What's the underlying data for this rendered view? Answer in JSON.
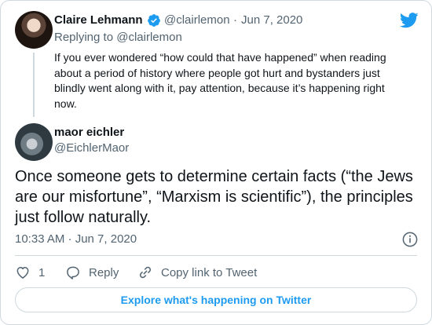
{
  "reply_tweet": {
    "author_name": "Claire Lehmann",
    "handle": "@clairlemon",
    "separator": "·",
    "date": "Jun 7, 2020",
    "replying_to": "Replying to @clairlemon",
    "text": "If you ever wondered “how could that have happened” when reading about a period of history where people got hurt and bystanders just blindly went along with it, pay attention, because it’s happening right now."
  },
  "main_tweet": {
    "author_name": "maor eichler",
    "handle": "@EichlerMaor",
    "text": "Once someone gets to determine certain facts (“the Jews are our misfortune”, “Marxism is scientific”), the principles just follow naturally.",
    "timestamp": "10:33 AM · Jun 7, 2020"
  },
  "actions": {
    "like_count": "1",
    "reply_label": "Reply",
    "copy_link_label": "Copy link to Tweet"
  },
  "footer": {
    "explore_label": "Explore what's happening on Twitter"
  },
  "colors": {
    "brand_blue": "#1d9bf0",
    "muted_text": "#536471",
    "border": "#cfd9de"
  },
  "icons": [
    "twitter-bird-icon",
    "verified-badge-icon",
    "info-icon",
    "heart-icon",
    "reply-bubble-icon",
    "link-icon"
  ]
}
